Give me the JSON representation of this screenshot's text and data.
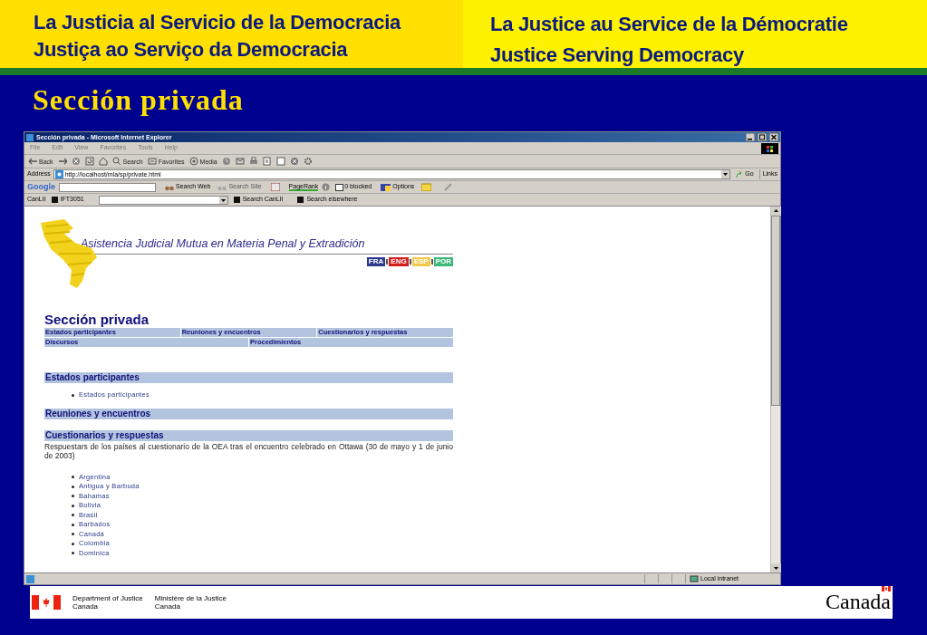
{
  "header": {
    "left_lines": [
      "La Justicia al Servicio de la Democracia",
      "Justiça ao Serviço da Democracia"
    ],
    "right_lines": [
      "La Justice au Service de la Démocratie",
      "Justice Serving Democracy"
    ]
  },
  "slide_title": "Sección privada",
  "browser": {
    "title": "Sección privada - Microsoft Internet Explorer",
    "menu": [
      "File",
      "Edit",
      "View",
      "Favorites",
      "Tools",
      "Help"
    ],
    "toolbar": [
      {
        "kind": "back",
        "label": "Back"
      },
      {
        "kind": "forward"
      },
      {
        "kind": "stop"
      },
      {
        "kind": "refresh"
      },
      {
        "kind": "home"
      },
      {
        "kind": "search",
        "label": "Search"
      },
      {
        "kind": "favorites",
        "label": "Favorites"
      },
      {
        "kind": "media",
        "label": "Media"
      },
      {
        "kind": "history"
      },
      {
        "kind": "mail"
      },
      {
        "kind": "print"
      },
      {
        "kind": "edit"
      },
      {
        "kind": "discuss"
      },
      {
        "kind": "messenger"
      },
      {
        "kind": "tools"
      }
    ],
    "address": {
      "label": "Address",
      "value": "http://localhost/mla/sp/private.html",
      "go": "Go",
      "links": "Links"
    },
    "google_bar": {
      "brand": "Google",
      "search_web": "Search Web",
      "search_site": "Search Site",
      "pagerank": "PageRank",
      "blocked": "0 blocked",
      "options": "Options"
    },
    "canlii_bar": {
      "brand": "CanLII",
      "item": "IFT3051",
      "search": "Search CanLII",
      "elsewhere": "Search elsewhere"
    },
    "page": {
      "banner": "Asistencia Judicial Mutua en Materia Penal y Extradición",
      "languages": [
        {
          "code": "FRA",
          "color": "#2b3a8f"
        },
        {
          "code": "ENG",
          "color": "#d42020"
        },
        {
          "code": "ESP",
          "color": "#f2c84b"
        },
        {
          "code": "POR",
          "color": "#3cb878"
        }
      ],
      "heading": "Sección privada",
      "nav_rows": [
        [
          "Estados participantes",
          "Reuniones y encuentros",
          "Cuestionarios y respuestas"
        ],
        [
          "Discursos",
          "Procedimientos"
        ]
      ],
      "sections": [
        {
          "title": "Estados participantes",
          "items": [
            "Estados participantes"
          ]
        },
        {
          "title": "Reuniones y encuentros"
        },
        {
          "title": "Cuestionarios y respuestas",
          "text": "Respuestars de los países al cuestionario de la OEA tras el encuentro celebrado en Ottawa (30 de mayo y 1 de junio de 2003)",
          "items": [
            "Argentina",
            "Antigua y Barbuda",
            "Bahamas",
            "Bolivia",
            "Brasil",
            "Barbados",
            "Canadá",
            "Colombia",
            "Dominica"
          ]
        }
      ]
    },
    "status": {
      "zone": "Local intranet"
    }
  },
  "footer": {
    "dept_en": [
      "Department of Justice",
      "Canada"
    ],
    "dept_fr": [
      "Ministère de la Justice",
      "Canada"
    ],
    "wordmark": "Canada"
  }
}
